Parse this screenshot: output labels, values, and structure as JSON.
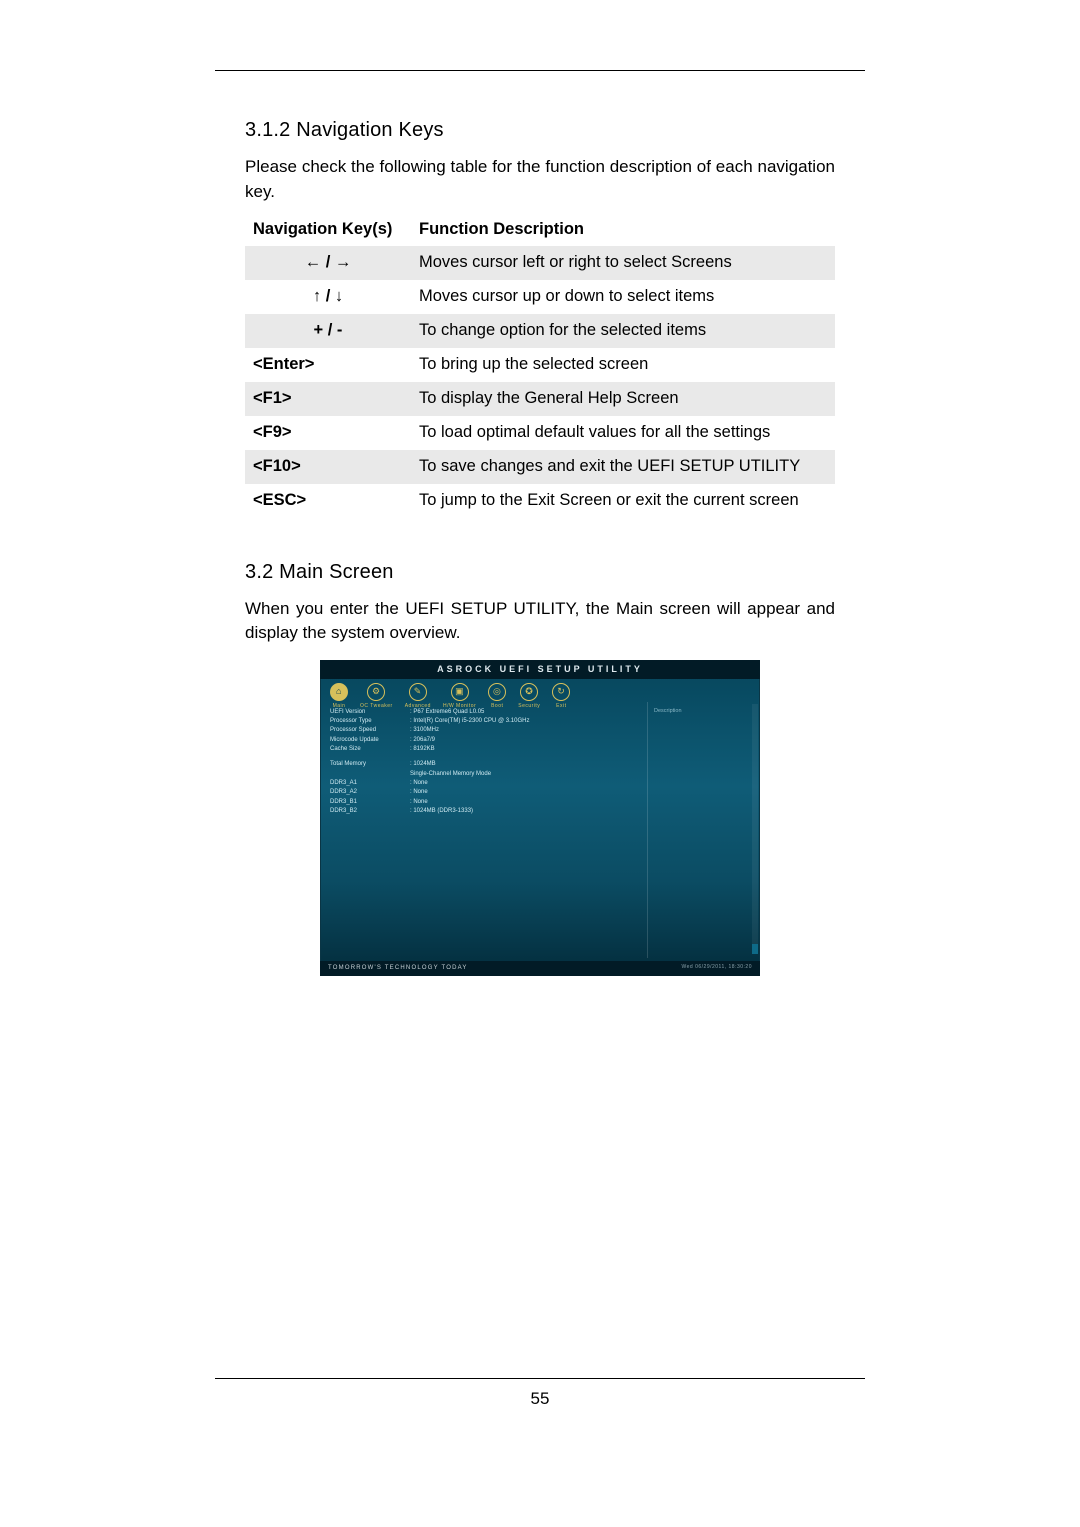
{
  "section312": {
    "heading": "3.1.2  Navigation Keys",
    "intro": "Please check the following table for the function description of each navigation key.",
    "th_keys": "Navigation Key(s)",
    "th_desc": "Function Description",
    "rows": [
      {
        "key": "←  /  →",
        "sym": true,
        "desc": "Moves cursor left or right to select Screens"
      },
      {
        "key": "↑  /  ↓",
        "sym": true,
        "desc": "Moves cursor up or down to select items"
      },
      {
        "key": "+  /  -",
        "sym": true,
        "desc": "To change option for the selected items"
      },
      {
        "key": "<Enter>",
        "sym": false,
        "desc": "To bring up the selected screen"
      },
      {
        "key": "<F1>",
        "sym": false,
        "desc": "To display the General Help Screen"
      },
      {
        "key": "<F9>",
        "sym": false,
        "desc": "To load optimal default values for all the settings"
      },
      {
        "key": "<F10>",
        "sym": false,
        "desc": "To save changes and exit the UEFI SETUP UTILITY"
      },
      {
        "key": "<ESC>",
        "sym": false,
        "desc": "To jump to the Exit Screen or exit the current screen"
      }
    ]
  },
  "section32": {
    "heading": "3.2  Main Screen",
    "intro": "When you enter the UEFI SETUP UTILITY, the Main screen will appear and display the system overview."
  },
  "uefi": {
    "title": "ASROCK UEFI SETUP UTILITY",
    "tabs": [
      "Main",
      "OC Tweaker",
      "Advanced",
      "H/W Monitor",
      "Boot",
      "Security",
      "Exit"
    ],
    "desc": "Description",
    "left_group1": [
      {
        "k": "UEFI Version",
        "v": ": P67 Extreme6 Quad L0.05"
      },
      {
        "k": "Processor Type",
        "v": ": Intel(R) Core(TM) i5-2300 CPU @ 3.10GHz"
      },
      {
        "k": "Processor Speed",
        "v": ": 3100MHz"
      },
      {
        "k": "Microcode Update",
        "v": ": 206a7/9"
      },
      {
        "k": "Cache Size",
        "v": ": 8192KB"
      }
    ],
    "left_group2": [
      {
        "k": "Total Memory",
        "v": ": 1024MB"
      },
      {
        "k": "",
        "v": "  Single-Channel Memory Mode"
      },
      {
        "k": "DDR3_A1",
        "v": ": None"
      },
      {
        "k": "DDR3_A2",
        "v": ": None"
      },
      {
        "k": "DDR3_B1",
        "v": ": None"
      },
      {
        "k": "DDR3_B2",
        "v": ": 1024MB (DDR3-1333)"
      }
    ],
    "footer_l": "TOMORROW'S TECHNOLOGY TODAY",
    "footer_r": "Wed 06/29/2011, 18:30:20"
  },
  "page_number": "55"
}
